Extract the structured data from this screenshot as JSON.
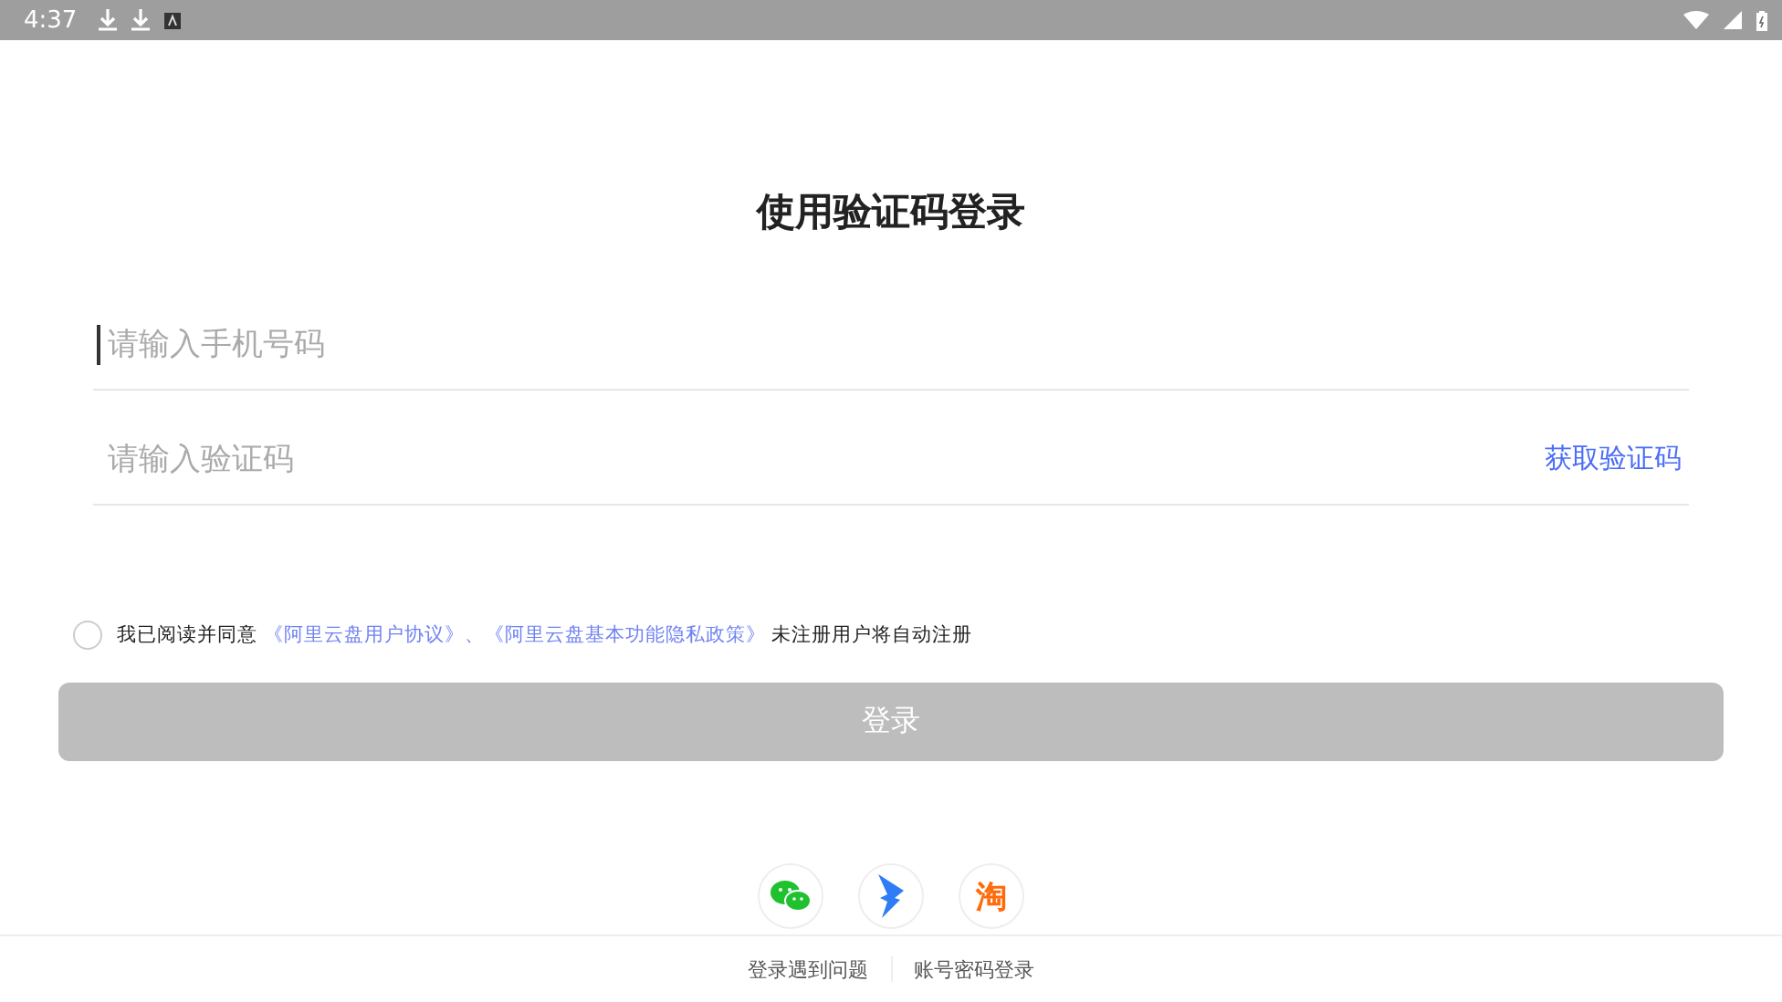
{
  "status_bar": {
    "time": "4:37"
  },
  "title": "使用验证码登录",
  "phone_field": {
    "placeholder": "请输入手机号码",
    "focused": true
  },
  "code_field": {
    "placeholder": "请输入验证码",
    "action": "获取验证码"
  },
  "agreement": {
    "checked": false,
    "prefix": "我已阅读并同意",
    "links": [
      "《阿里云盘用户协议》",
      "《阿里云盘基本功能隐私政策》"
    ],
    "separator": "、",
    "suffix": "未注册用户将自动注册"
  },
  "login_button": {
    "label": "登录",
    "disabled": true
  },
  "social_logins": [
    {
      "kind": "wechat"
    },
    {
      "kind": "dingtalk"
    },
    {
      "kind": "taobao",
      "glyph": "淘"
    }
  ],
  "footer_links": [
    "登录遇到问题",
    "账号密码登录"
  ]
}
